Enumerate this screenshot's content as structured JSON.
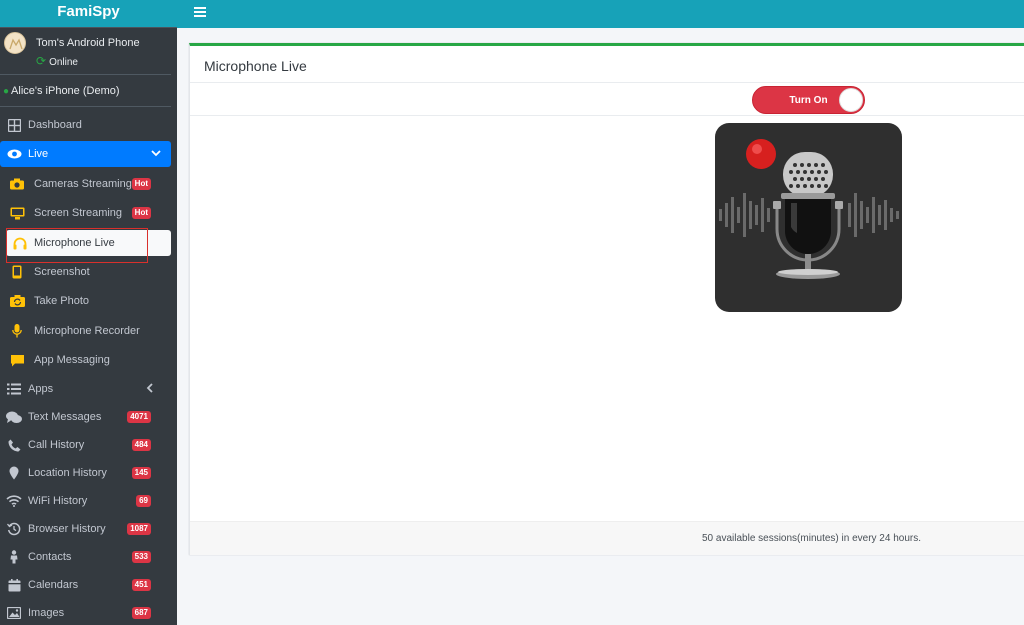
{
  "sidebar": {
    "brand": "FamiSpy",
    "user": {
      "name": "Tom's Android Phone",
      "status": "Online"
    },
    "device": "Alice's iPhone (Demo)",
    "items": [
      {
        "label": "Dashboard",
        "icon": "grid-icon"
      },
      {
        "label": "Live",
        "icon": "eye-icon"
      },
      {
        "label": "Cameras Streaming",
        "icon": "camera-icon",
        "badge": "Hot"
      },
      {
        "label": "Screen Streaming",
        "icon": "monitor-icon",
        "badge": "Hot"
      },
      {
        "label": "Microphone Live",
        "icon": "headphones-icon"
      },
      {
        "label": "Screenshot",
        "icon": "phone-icon"
      },
      {
        "label": "Take Photo",
        "icon": "camera-rotate-icon"
      },
      {
        "label": "Microphone Recorder",
        "icon": "microphone-icon"
      },
      {
        "label": "App Messaging",
        "icon": "chat-icon"
      },
      {
        "label": "Apps",
        "icon": "list-icon"
      },
      {
        "label": "Text Messages",
        "icon": "comments-icon",
        "badge": "4071"
      },
      {
        "label": "Call History",
        "icon": "phone-call-icon",
        "badge": "484"
      },
      {
        "label": "Location History",
        "icon": "map-marker-icon",
        "badge": "145"
      },
      {
        "label": "WiFi History",
        "icon": "wifi-icon",
        "badge": "69"
      },
      {
        "label": "Browser History",
        "icon": "history-icon",
        "badge": "1087"
      },
      {
        "label": "Contacts",
        "icon": "person-icon",
        "badge": "533"
      },
      {
        "label": "Calendars",
        "icon": "calendar-icon",
        "badge": "451"
      },
      {
        "label": "Images",
        "icon": "image-icon",
        "badge": "687"
      }
    ]
  },
  "main": {
    "title": "Microphone Live",
    "toggle_label": "Turn On",
    "footer": "50 available sessions(minutes) in every 24 hours."
  },
  "colors": {
    "topbar": "#17a2b8",
    "sidebar": "#343a40",
    "active": "#007bff",
    "badge": "#dc3545",
    "accent_icon": "#ffc107",
    "card_border": "#28a745"
  }
}
